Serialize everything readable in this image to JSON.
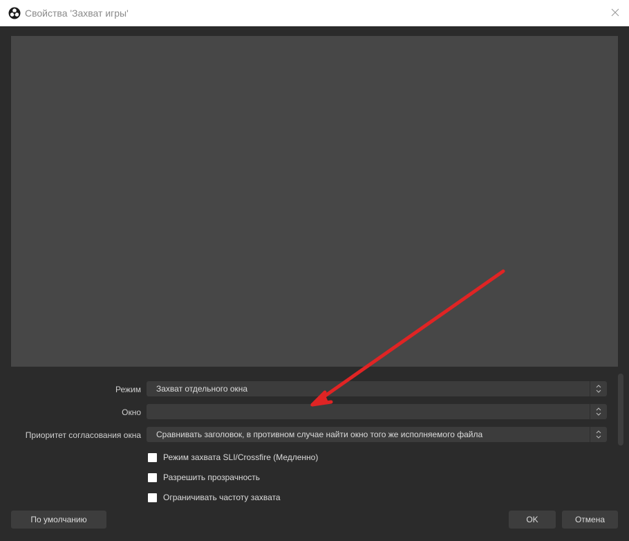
{
  "window": {
    "title": "Свойства 'Захват игры'"
  },
  "properties": {
    "mode": {
      "label": "Режим",
      "value": "Захват отдельного окна"
    },
    "window_field": {
      "label": "Окно",
      "value": ""
    },
    "priority": {
      "label": "Приоритет согласования окна",
      "value": "Сравнивать заголовок, в противном случае найти окно того же исполняемого файла"
    }
  },
  "checkboxes": [
    {
      "label": "Режим захвата SLI/Crossfire (Медленно)",
      "checked": false
    },
    {
      "label": "Разрешить прозрачность",
      "checked": false
    },
    {
      "label": "Ограничивать частоту захвата",
      "checked": false
    }
  ],
  "buttons": {
    "defaults": "По умолчанию",
    "ok": "OK",
    "cancel": "Отмена"
  },
  "icons": {
    "app": "obs-logo-icon",
    "close": "close-icon",
    "spin": "up-down-chevron-icon"
  },
  "colors": {
    "annotation_arrow": "#e02424",
    "background": "#2b2b2b",
    "preview": "#474747"
  }
}
